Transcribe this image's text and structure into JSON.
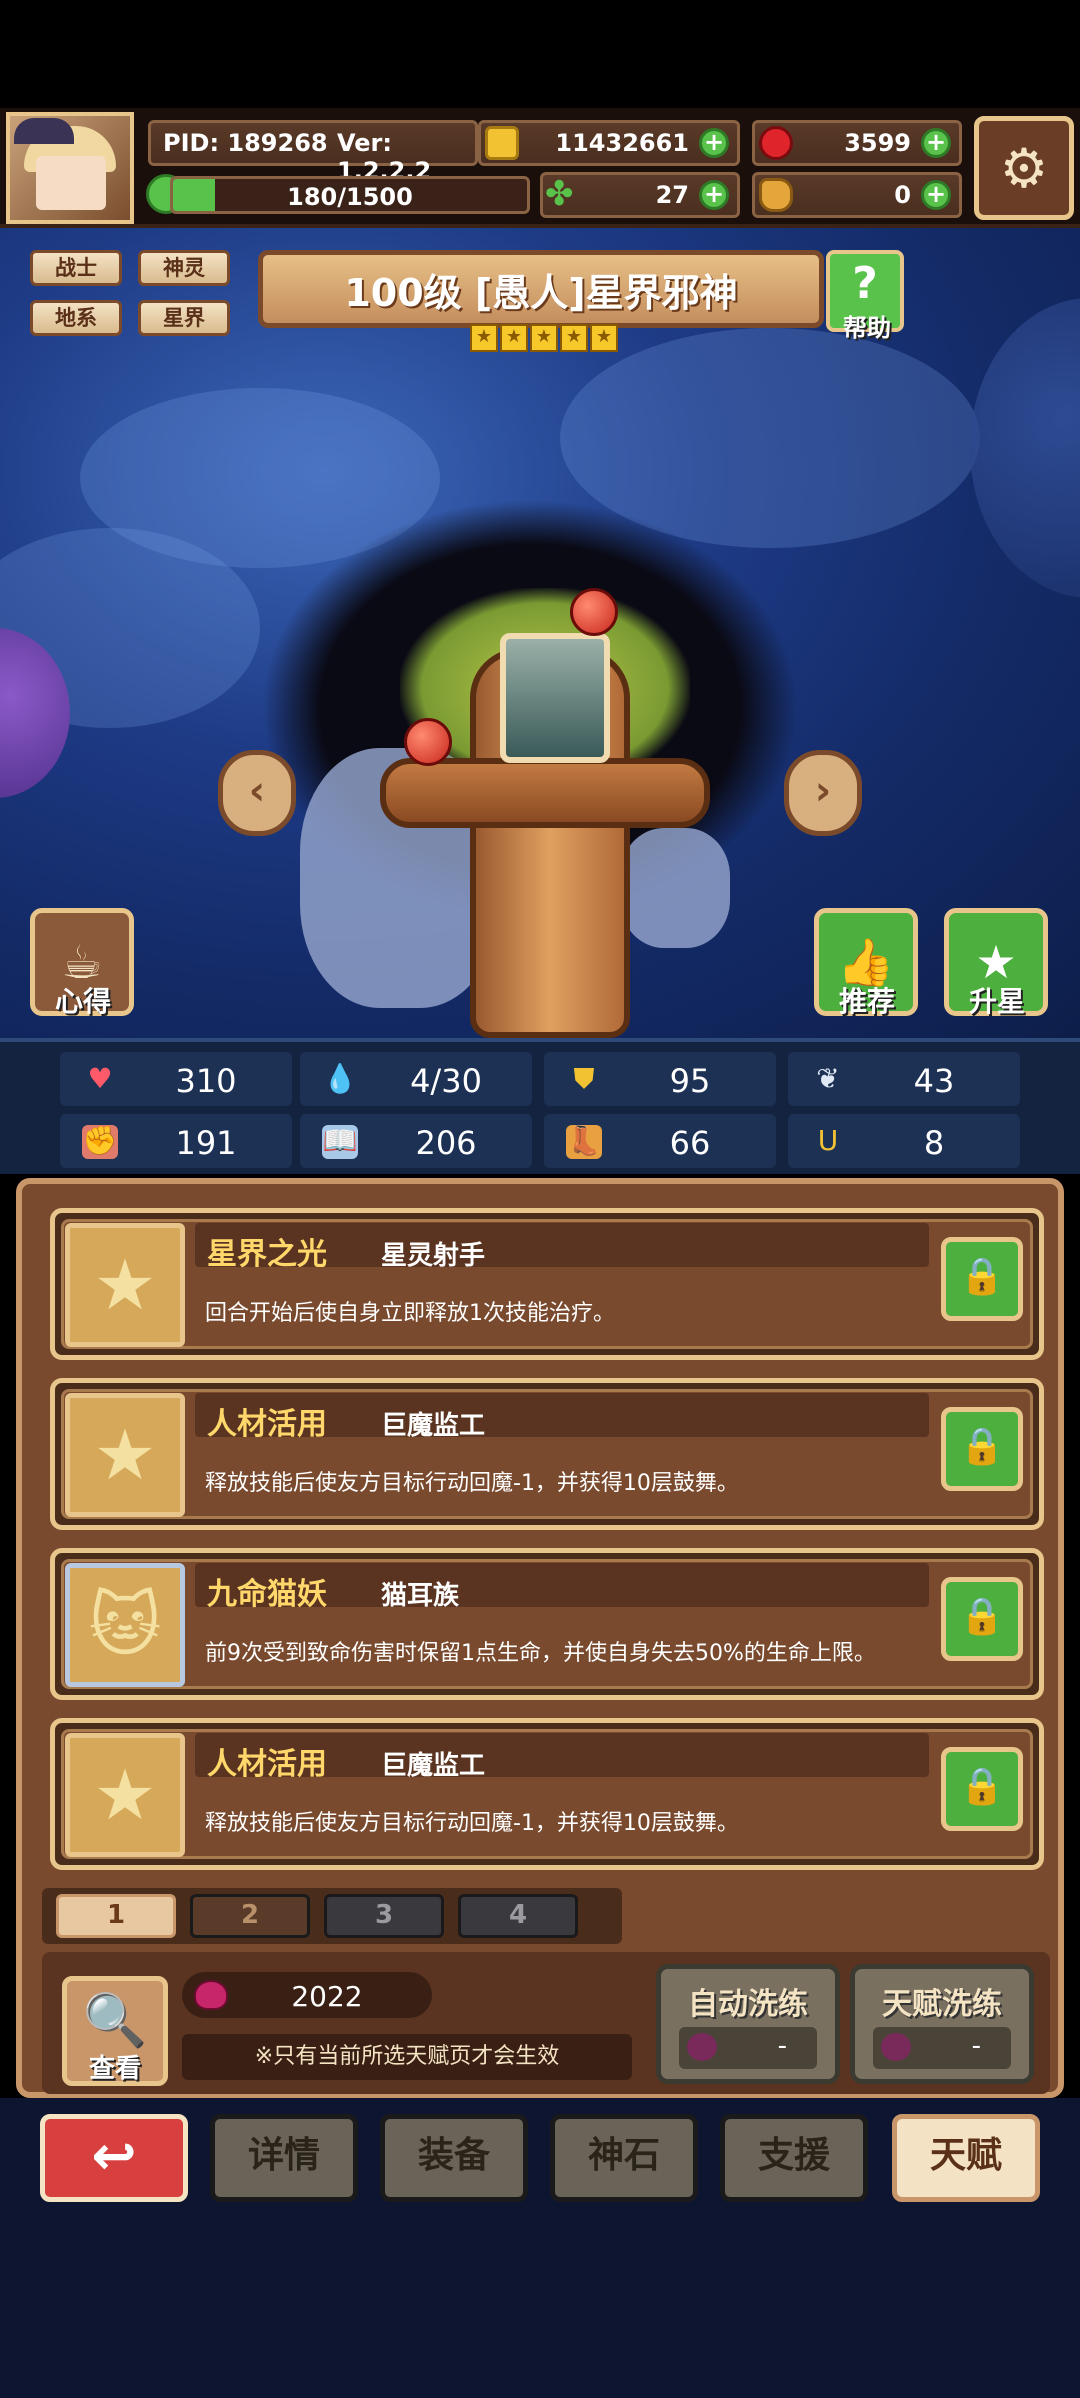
{
  "header": {
    "pid": "PID: 189268",
    "version": "Ver: 1.2.2.2",
    "gold": "11432661",
    "gems": "3599",
    "stamina": "180/1500",
    "stamina_fraction": 0.12,
    "clover": "27",
    "bag": "0",
    "plus": "+"
  },
  "hero": {
    "title": "100级 [愚人]星界邪神",
    "stars": 5,
    "tags": [
      "战士",
      "神灵",
      "地系",
      "星界"
    ],
    "help_label": "帮助",
    "help_glyph": "?"
  },
  "side_buttons": {
    "insight": "心得",
    "recommend": "推荐",
    "upgrade_star": "升星"
  },
  "stats": [
    {
      "icon": "heart-icon",
      "value": "310"
    },
    {
      "icon": "water-drop-icon",
      "value": "4/30"
    },
    {
      "icon": "shield-icon",
      "value": "95"
    },
    {
      "icon": "wing-icon",
      "value": "43"
    },
    {
      "icon": "fist-icon",
      "value": "191"
    },
    {
      "icon": "book-icon",
      "value": "206"
    },
    {
      "icon": "boot-icon",
      "value": "66"
    },
    {
      "icon": "horseshoe-icon",
      "value": "8"
    }
  ],
  "talents": [
    {
      "name": "星界之光",
      "source": "星灵射手",
      "desc": "回合开始后使自身立即释放1次技能治疗。"
    },
    {
      "name": "人材活用",
      "source": "巨魔监工",
      "desc": "释放技能后使友方目标行动回魔-1，并获得10层鼓舞。"
    },
    {
      "name": "九命猫妖",
      "source": "猫耳族",
      "desc": "前9次受到致命伤害时保留1点生命，并使自身失去50%的生命上限。"
    },
    {
      "name": "人材活用",
      "source": "巨魔监工",
      "desc": "释放技能后使友方目标行动回魔-1，并获得10层鼓舞。"
    }
  ],
  "pages": [
    "1",
    "2",
    "3",
    "4"
  ],
  "bottom": {
    "search_label": "查看",
    "count": "2022",
    "note": "※只有当前所选天赋页才会生效",
    "auto_wash": "自动洗练",
    "talent_wash": "天赋洗练",
    "cost_dash": "-"
  },
  "nav": [
    "详情",
    "装备",
    "神石",
    "支援",
    "天赋"
  ],
  "colors": {
    "accent_green": "#58c24a",
    "panel_brown": "#7a4a2e",
    "gold_text": "#ffd76a",
    "back_red": "#d84040"
  }
}
